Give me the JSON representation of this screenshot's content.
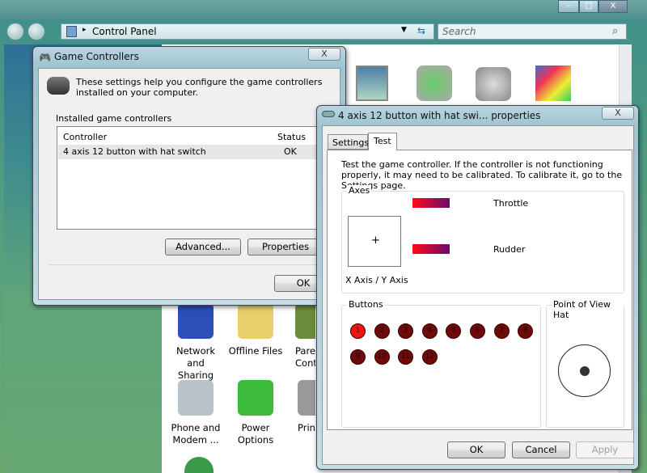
{
  "explorer": {
    "address": "Control Panel",
    "search_placeholder": "Search",
    "window_buttons": {
      "minimize": "–",
      "maximize": "□",
      "close": "X"
    },
    "items": [
      {
        "label1": "Network and",
        "label2": "Sharing Ce...",
        "color": "#2a4fb8"
      },
      {
        "label1": "Offline Files",
        "label2": "",
        "color": "#e9cf6c"
      },
      {
        "label1": "Pare",
        "label2": "Cont",
        "color": "#6b8c3d"
      },
      {
        "label1": "Phone and",
        "label2": "Modem ...",
        "color": "#b8c2c9"
      },
      {
        "label1": "Power",
        "label2": "Options",
        "color": "#3dbb3d"
      },
      {
        "label1": "Prin",
        "label2": "",
        "color": "#999"
      }
    ]
  },
  "game_controllers": {
    "title": "Game Controllers",
    "description": "These settings help you configure the game controllers installed on your computer.",
    "group_label": "Installed game controllers",
    "columns": [
      "Controller",
      "Status"
    ],
    "rows": [
      {
        "controller": "4 axis 12 button  with hat switch",
        "status": "OK"
      }
    ],
    "advanced": "Advanced...",
    "properties": "Properties",
    "ok": "OK",
    "close": "X"
  },
  "properties": {
    "title": "4 axis 12 button  with hat swi... properties",
    "close": "X",
    "tabs": [
      "Settings",
      "Test"
    ],
    "active_tab": "Test",
    "description": "Test the game controller.  If the controller is not functioning properly, it may need to be calibrated.  To calibrate it, go to the Settings page.",
    "axes_label": "Axes",
    "throttle": "Throttle",
    "rudder": "Rudder",
    "xy_label": "X Axis / Y Axis",
    "crosshair": "+",
    "buttons_label": "Buttons",
    "buttons": [
      {
        "n": "1",
        "pressed": true
      },
      {
        "n": "2",
        "pressed": false
      },
      {
        "n": "3",
        "pressed": false
      },
      {
        "n": "4",
        "pressed": false
      },
      {
        "n": "5",
        "pressed": false
      },
      {
        "n": "6",
        "pressed": false
      },
      {
        "n": "7",
        "pressed": false
      },
      {
        "n": "8",
        "pressed": false
      },
      {
        "n": "9",
        "pressed": false
      },
      {
        "n": "10",
        "pressed": false
      },
      {
        "n": "11",
        "pressed": false
      },
      {
        "n": "12",
        "pressed": false
      }
    ],
    "pov_label": "Point of View Hat",
    "ok": "OK",
    "cancel": "Cancel",
    "apply": "Apply"
  }
}
